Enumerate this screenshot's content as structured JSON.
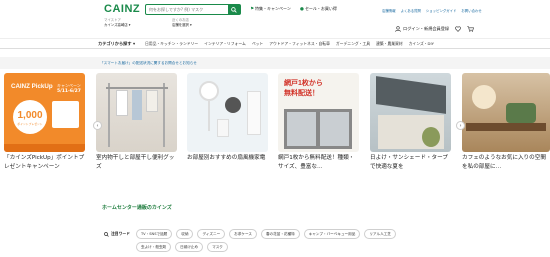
{
  "header": {
    "logo": "CAINZ",
    "store1_label": "マイストア",
    "store1_value": "カインズ高崎店 ▾",
    "store2_label": "近くのお店",
    "store2_value": "店舗を選択 ▾",
    "search_placeholder": "何をお探しですか? 例) マスク",
    "promo1": "特集・キャンペーン",
    "promo2": "セール・お買い得",
    "util_links": [
      "店舗情報",
      "よくある質問",
      "ショッピングガイド",
      "お問い合わせ"
    ],
    "login_label": "ログイン・新規会員登録"
  },
  "nav": {
    "all_label": "カテゴリから探す",
    "categories": [
      "日用品・キッチン・ランドリー",
      "インテリア・リフォーム",
      "ペット",
      "アウトドア・フィットネス・自転車",
      "ガーデニング・工具",
      "建築・農業資材",
      "カインズ・DIY"
    ]
  },
  "notice": "「スマートお届け」の配送状況に関するお問合せとお知らせ",
  "cards": [
    {
      "title": "「カインズPickUp」ポイントプレゼントキャンペーン",
      "banner_title": "CAINZ PickUp",
      "banner_sub": "キャンペーン",
      "banner_date": "5/11-6/27",
      "banner_points": "1,000",
      "banner_unit": "ポイントプレゼント"
    },
    {
      "title": "室内物干しと部屋干し便利グッズ"
    },
    {
      "title": "お部屋別おすすめの扇風機家電"
    },
    {
      "title": "網戸1枚から無料配送！種類・サイズ、豊富な…",
      "banner_line1": "網戸1枚から",
      "banner_line2": "無料配送！"
    },
    {
      "title": "日よけ・サンシェード・タープで快適な夏を"
    },
    {
      "title": "カフェのようなお気に入りの空間を私の部屋に…"
    }
  ],
  "section": {
    "title": "ホームセンター通販のカインズ",
    "tags_head": "注目ワード",
    "tags_row1": [
      "TV・SNSで話題",
      "収納",
      "ディズニー",
      "お求ケース",
      "春の花苗・花種特",
      "キャンプ・バーベキュー用品",
      "リアル人工芝"
    ],
    "tags_row2": [
      "虫よけ・殺虫剤",
      "日焼け止め",
      "マスク"
    ]
  },
  "colors": {
    "brand_green": "#1a8a4a",
    "banner_orange": "#f28a2a"
  }
}
